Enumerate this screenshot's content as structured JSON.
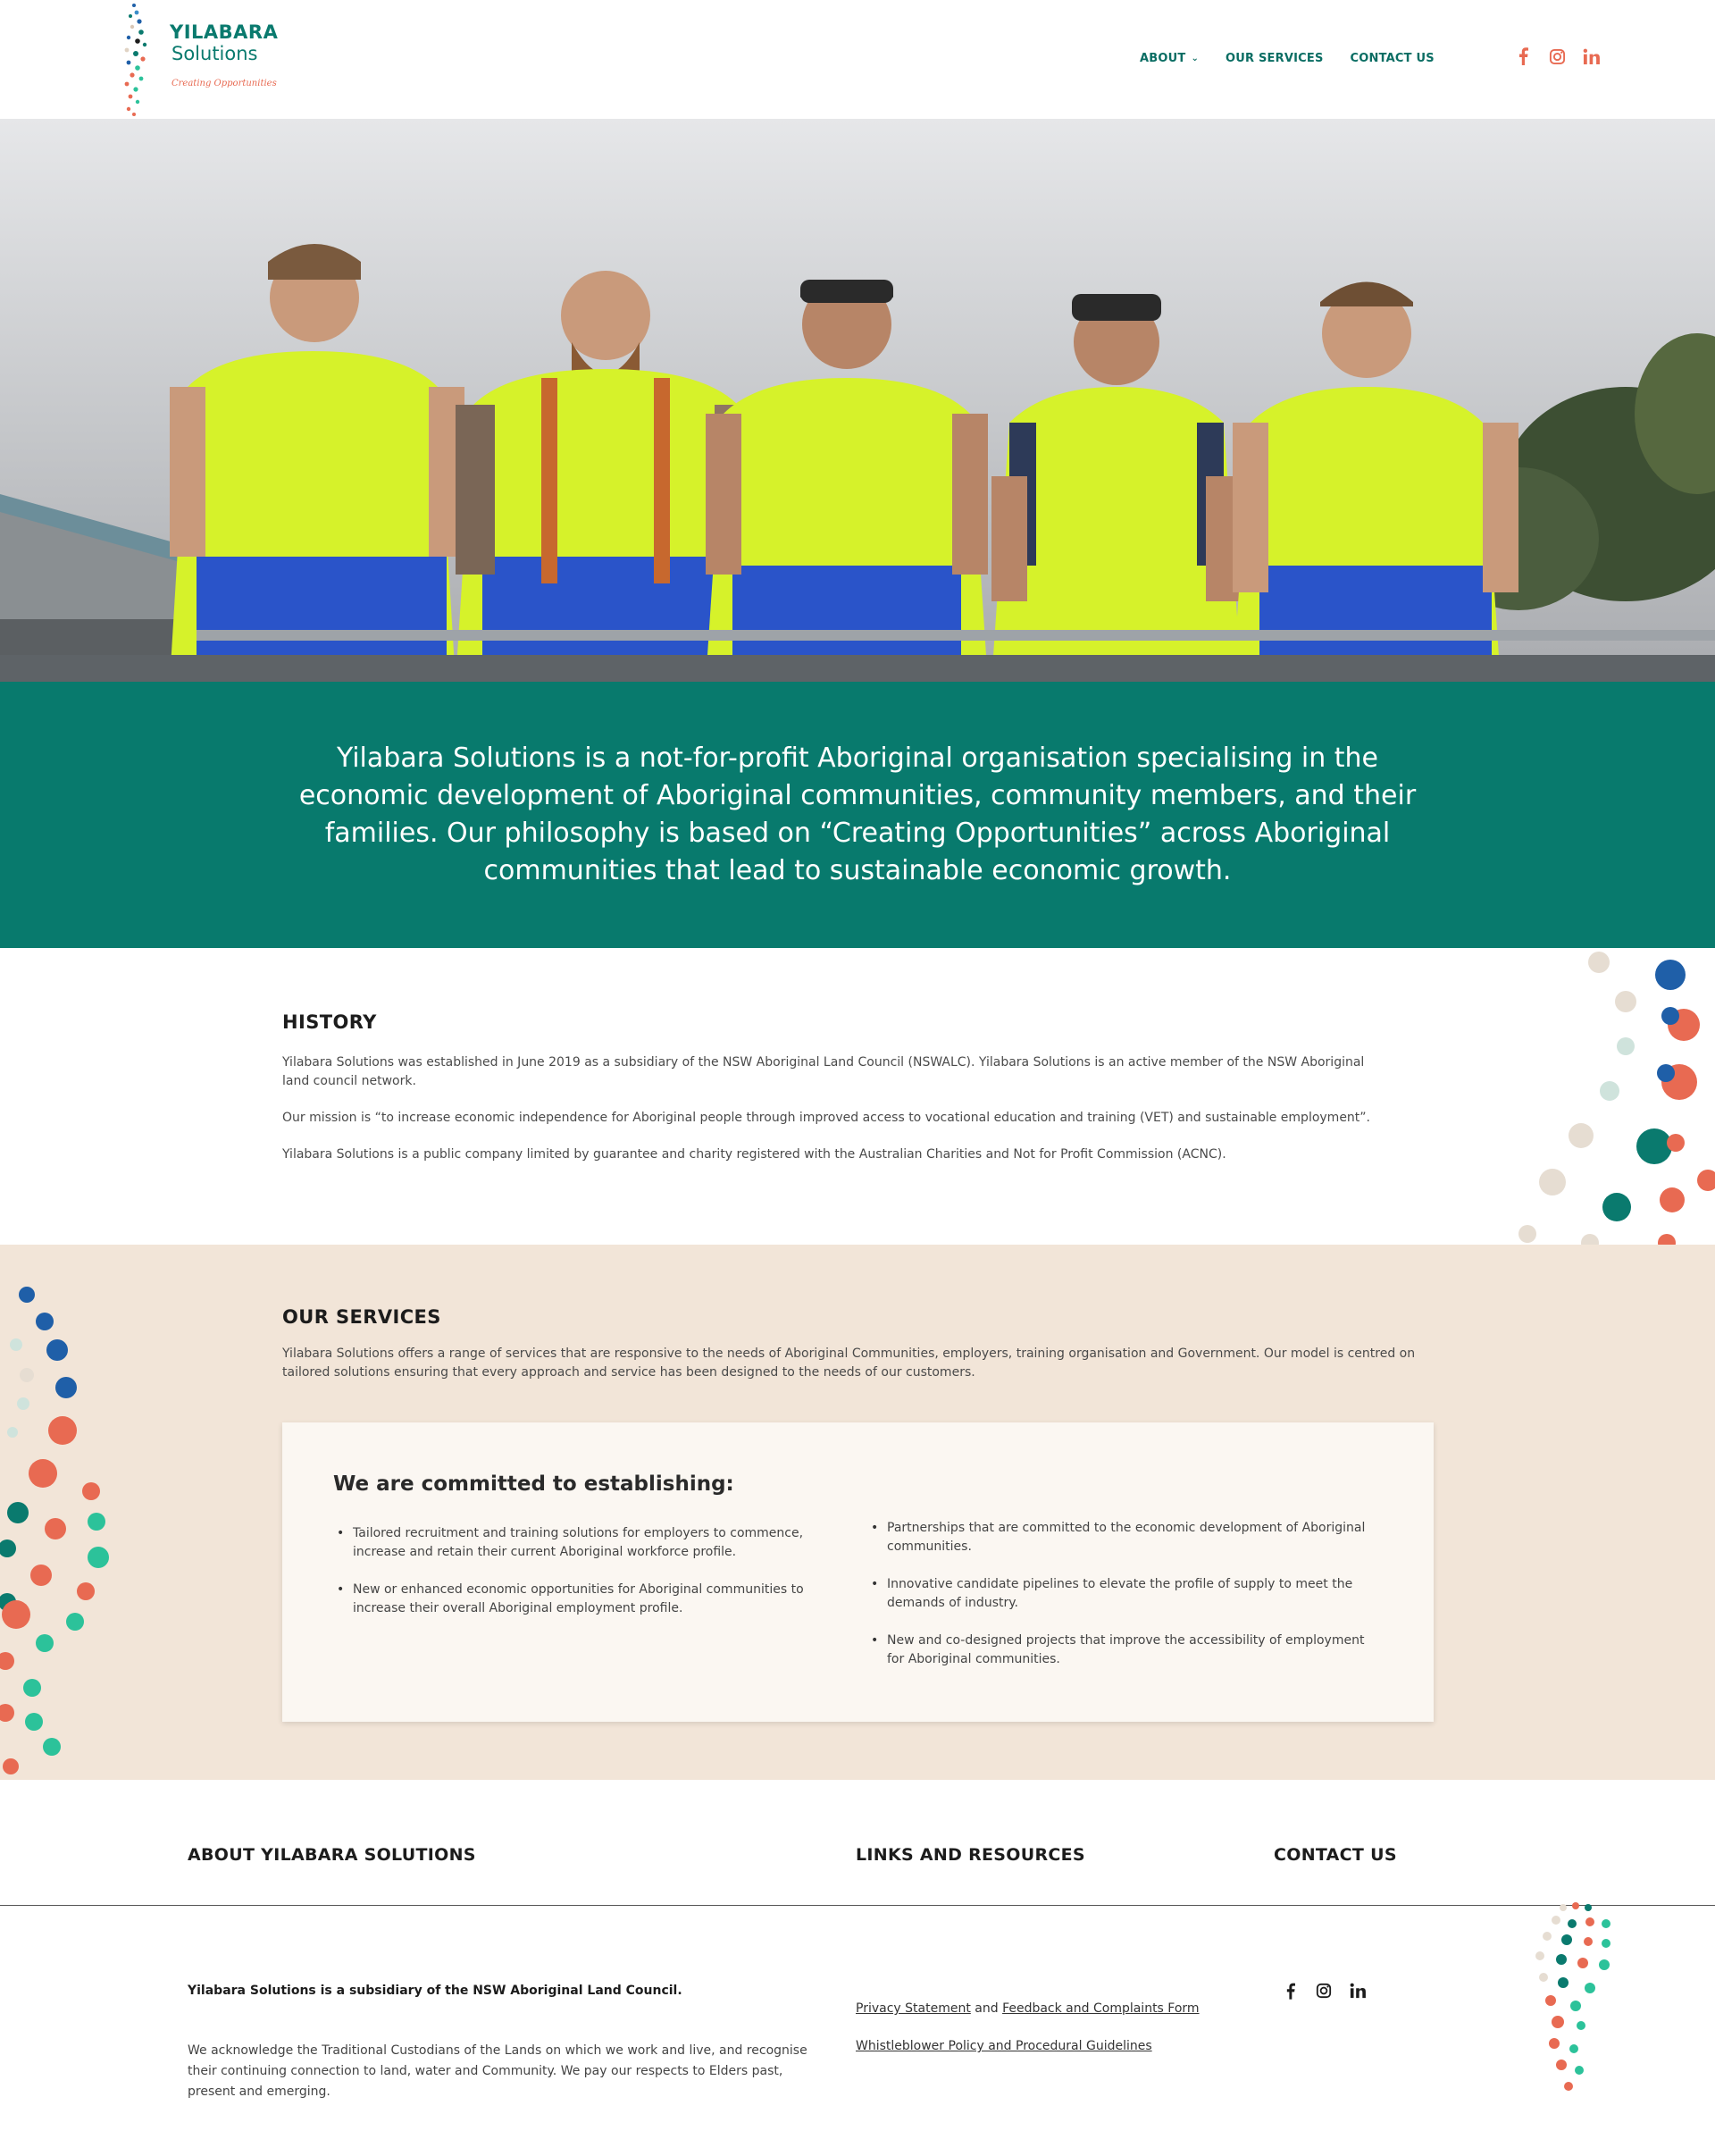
{
  "brand": {
    "name": "YILABARA",
    "sub": "Solutions",
    "tagline": "Creating Opportunities",
    "primary_color": "#087a6d",
    "accent_color": "#e86a52"
  },
  "nav": {
    "items": [
      {
        "label": "ABOUT",
        "has_dropdown": true
      },
      {
        "label": "OUR SERVICES"
      },
      {
        "label": "CONTACT US"
      }
    ]
  },
  "social": [
    "facebook-icon",
    "instagram-icon",
    "linkedin-icon"
  ],
  "intro": {
    "text": "Yilabara Solutions is a not-for-profit Aboriginal organisation specialising in the economic development of Aboriginal communities, community members, and their families. Our philosophy is based on “Creating Opportunities” across Aboriginal communities that lead to sustainable economic growth."
  },
  "history": {
    "title": "HISTORY",
    "paragraphs": [
      "Yilabara Solutions was established in June 2019 as a subsidiary of the NSW Aboriginal Land Council (NSWALC). Yilabara Solutions is an active member of the NSW Aboriginal land council network.",
      "Our mission is “to increase economic independence for Aboriginal people through improved access to vocational education and training (VET) and sustainable employment”.",
      "Yilabara Solutions is a public company limited by guarantee and charity registered with the Australian Charities and Not for Profit Commission (ACNC)."
    ]
  },
  "services": {
    "title": "OUR SERVICES",
    "intro": "Yilabara Solutions offers a range of services that are responsive to the needs of Aboriginal Communities, employers, training organisation and Government. Our model is centred on tailored solutions ensuring that every approach and service has been designed to the needs of our customers.",
    "card_title": "We are committed to establishing:",
    "left": [
      "Tailored recruitment and training solutions for employers to commence, increase and retain their current Aboriginal workforce profile.",
      "New or enhanced economic opportunities for Aboriginal communities to increase their overall Aboriginal employment profile."
    ],
    "right": [
      "Partnerships that are committed to the economic development of Aboriginal communities.",
      "Innovative candidate pipelines to elevate the profile of supply to meet the demands of industry.",
      "New and co-designed projects that improve the accessibility of employment for Aboriginal communities."
    ]
  },
  "footer": {
    "about_title": "ABOUT YILABARA SOLUTIONS",
    "links_title": "LINKS AND RESOURCES",
    "contact_title": "CONTACT US",
    "subsidiary": "Yilabara Solutions is a subsidiary of the NSW Aboriginal Land Council.",
    "acknowledgement": "We acknowledge the Traditional Custodians of the Lands on which we work and live, and recognise their continuing connection to land, water and Community. We pay our respects to Elders past, present and emerging.",
    "privacy": "Privacy Statement",
    "and": "and",
    "feedback": "Feedback and Complaints Form",
    "whistleblower": "Whistleblower Policy and Procedural Guidelines"
  }
}
